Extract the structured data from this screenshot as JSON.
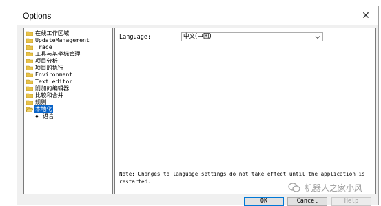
{
  "window": {
    "title": "Options",
    "close_glyph": "✕"
  },
  "tree": {
    "items": [
      {
        "label": "在线工作区域"
      },
      {
        "label": "UpdateManagement"
      },
      {
        "label": "Trace"
      },
      {
        "label": "工具与基坐标管理"
      },
      {
        "label": "项目分析"
      },
      {
        "label": "项目的执行"
      },
      {
        "label": "Environment"
      },
      {
        "label": "Text editor"
      },
      {
        "label": "附加的编辑器"
      },
      {
        "label": "比较和合并"
      },
      {
        "label": "规则"
      },
      {
        "label": "本地化",
        "selected": true
      }
    ],
    "child": {
      "label": "语言",
      "bullet": "◆"
    }
  },
  "panel": {
    "language_label": "Language:",
    "language_value": "中文(中国)",
    "note": "Note: Changes to language settings do not take effect until the application is restarted."
  },
  "buttons": {
    "ok": "OK",
    "cancel": "Cancel",
    "help": "Help"
  },
  "watermark": {
    "text": "机器人之家小风"
  },
  "colors": {
    "selection": "#0a64c8",
    "folder": "#e8c24a"
  }
}
